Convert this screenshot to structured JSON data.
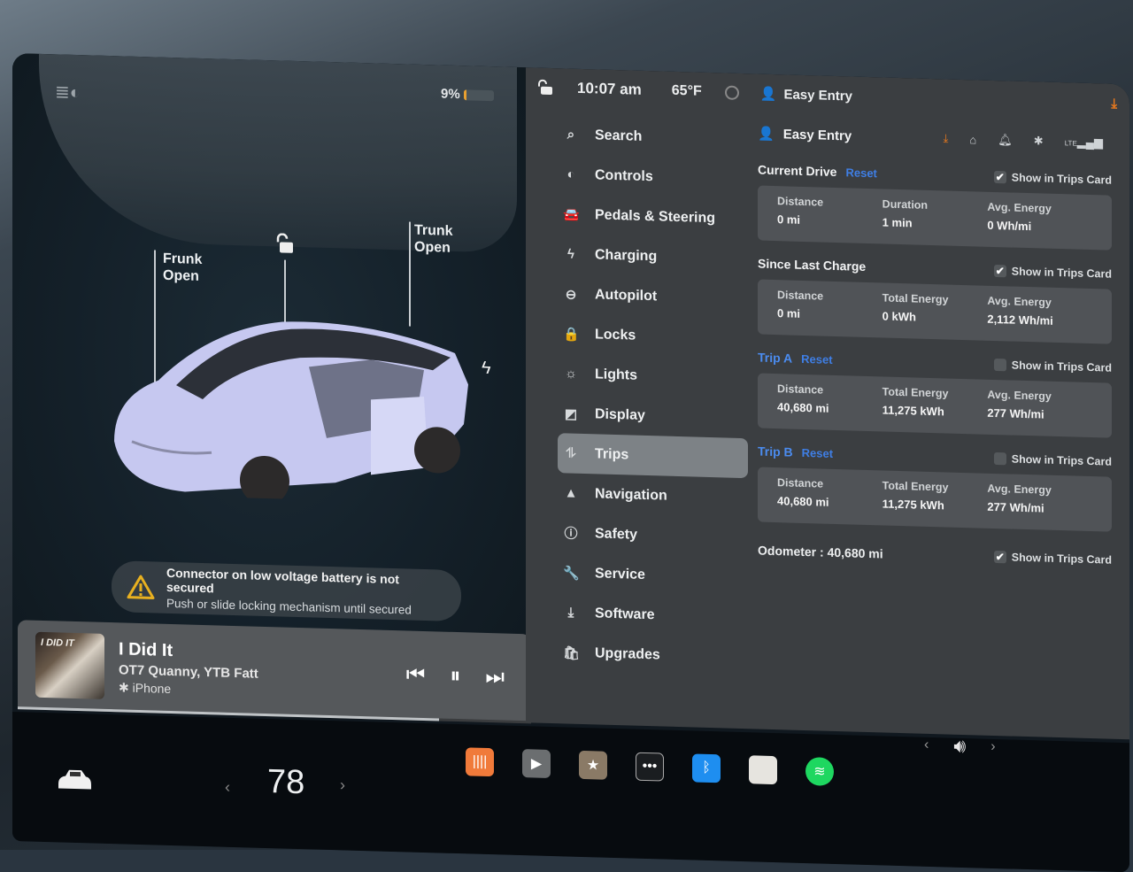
{
  "car_panel": {
    "battery_percent_label": "9%",
    "battery_level": 0.09,
    "battery_color": "#e8a030",
    "frunk": {
      "name": "Frunk",
      "state": "Open"
    },
    "trunk": {
      "name": "Trunk",
      "state": "Open"
    },
    "lock_state": "unlocked",
    "charge_port_icon": "lightning-icon",
    "alert": {
      "icon": "warning-icon",
      "title": "Connector on low voltage battery is not secured",
      "message": "Push or slide locking mechanism until secured",
      "color": "#e8b020"
    }
  },
  "media": {
    "album_art_text": "I DID IT",
    "title": "I Did It",
    "artist": "OT7 Quanny, YTB Fatt",
    "source": "iPhone",
    "source_icon": "bluetooth-icon",
    "controls": {
      "previous": "⏮",
      "pause": "⏸",
      "next": "⏭"
    },
    "progress": 0.82
  },
  "status_bar": {
    "time": "10:07 am",
    "temperature": "65°F",
    "profile": "Easy Entry",
    "download_icon": "download-icon"
  },
  "settings": {
    "nav": [
      {
        "id": "search",
        "label": "Search",
        "icon": "⌕"
      },
      {
        "id": "controls",
        "label": "Controls",
        "icon": "◐"
      },
      {
        "id": "pedals",
        "label": "Pedals & Steering",
        "icon": "🚘"
      },
      {
        "id": "charging",
        "label": "Charging",
        "icon": "ϟ"
      },
      {
        "id": "autopilot",
        "label": "Autopilot",
        "icon": "⊖"
      },
      {
        "id": "locks",
        "label": "Locks",
        "icon": "🔒"
      },
      {
        "id": "lights",
        "label": "Lights",
        "icon": "☼"
      },
      {
        "id": "display",
        "label": "Display",
        "icon": "◩"
      },
      {
        "id": "trips",
        "label": "Trips",
        "icon": "⥮",
        "active": true
      },
      {
        "id": "navigation",
        "label": "Navigation",
        "icon": "▲"
      },
      {
        "id": "safety",
        "label": "Safety",
        "icon": "ⓘ"
      },
      {
        "id": "service",
        "label": "Service",
        "icon": "🔧"
      },
      {
        "id": "software",
        "label": "Software",
        "icon": "⤓"
      },
      {
        "id": "upgrades",
        "label": "Upgrades",
        "icon": "🛍"
      }
    ],
    "profile_name": "Easy Entry",
    "sys_icons": [
      "download-icon",
      "garage-icon",
      "bell-icon",
      "bluetooth-icon",
      "lte-signal-icon"
    ],
    "sys_icon_labels": {
      "lte": "LTE"
    },
    "show_in_trips_card_label": "Show in Trips Card",
    "reset_label": "Reset",
    "sections": [
      {
        "title": "Current Drive",
        "title_style": "white",
        "has_reset": true,
        "show_in_card": true,
        "stats": [
          {
            "label": "Distance",
            "value": "0 mi"
          },
          {
            "label": "Duration",
            "value": "1 min"
          },
          {
            "label": "Avg. Energy",
            "value": "0 Wh/mi"
          }
        ]
      },
      {
        "title": "Since Last Charge",
        "title_style": "white",
        "has_reset": false,
        "show_in_card": true,
        "stats": [
          {
            "label": "Distance",
            "value": "0 mi"
          },
          {
            "label": "Total Energy",
            "value": "0 kWh"
          },
          {
            "label": "Avg. Energy",
            "value": "2,112 Wh/mi"
          }
        ]
      },
      {
        "title": "Trip A",
        "title_style": "blue",
        "has_reset": true,
        "show_in_card": false,
        "stats": [
          {
            "label": "Distance",
            "value": "40,680 mi"
          },
          {
            "label": "Total Energy",
            "value": "11,275 kWh"
          },
          {
            "label": "Avg. Energy",
            "value": "277 Wh/mi"
          }
        ]
      },
      {
        "title": "Trip B",
        "title_style": "blue",
        "has_reset": true,
        "show_in_card": false,
        "stats": [
          {
            "label": "Distance",
            "value": "40,680 mi"
          },
          {
            "label": "Total Energy",
            "value": "11,275 kWh"
          },
          {
            "label": "Avg. Energy",
            "value": "277 Wh/mi"
          }
        ]
      }
    ],
    "odometer_label": "Odometer :",
    "odometer_value": "40,680 mi",
    "odometer_show_in_card": true
  },
  "taskbar": {
    "car_icon": "car-icon",
    "temperature": "78",
    "temp_down": "‹",
    "temp_up": "›",
    "apps": [
      {
        "id": "audio",
        "icon": "waveform-icon",
        "glyph": "||||",
        "color": "#f07a3a"
      },
      {
        "id": "theater",
        "icon": "clapperboard-icon",
        "glyph": "▶",
        "color": "#6b6e70"
      },
      {
        "id": "toybox",
        "icon": "toybox-icon",
        "glyph": "★",
        "color": "#8a7a66"
      },
      {
        "id": "more",
        "icon": "more-icon",
        "glyph": "•••",
        "color": "#1a1d20"
      },
      {
        "id": "bluetooth",
        "icon": "bluetooth-icon",
        "glyph": "ᛒ",
        "color": "#1e8ef0"
      },
      {
        "id": "notes",
        "icon": "notepad-icon",
        "glyph": "",
        "color": "#e6e4df"
      },
      {
        "id": "spotify",
        "icon": "spotify-icon",
        "glyph": "≋",
        "color": "#1ed760"
      }
    ],
    "volume": {
      "icon": "speaker-icon",
      "left": "‹",
      "right": "›"
    }
  }
}
